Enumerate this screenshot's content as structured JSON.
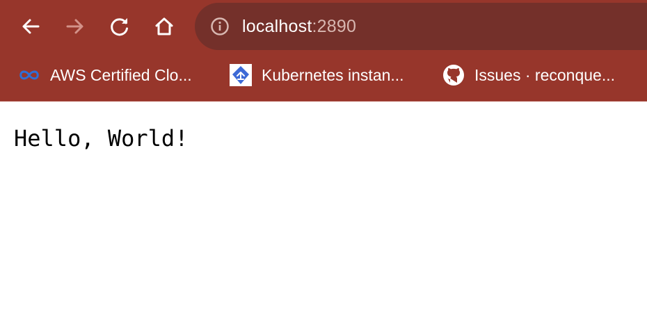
{
  "toolbar": {
    "back_icon": "arrow-left-icon",
    "forward_icon": "arrow-right-icon",
    "reload_icon": "reload-icon",
    "home_icon": "home-icon",
    "omnibox": {
      "info_icon": "info-icon",
      "host": "localhost",
      "port": ":2890"
    }
  },
  "bookmarks": [
    {
      "label": "AWS Certified Clo...",
      "icon": "infinity-logo-icon"
    },
    {
      "label": "Kubernetes instan...",
      "icon": "kubernetes-logo-icon"
    },
    {
      "label": "Issues · reconque...",
      "icon": "github-logo-icon"
    }
  ],
  "page": {
    "text": "Hello, World!"
  },
  "colors": {
    "chrome_bg": "#97362b",
    "omnibox_bg": "#74302a",
    "port_text": "#d8b7b1",
    "page_bg": "#ffffff"
  }
}
